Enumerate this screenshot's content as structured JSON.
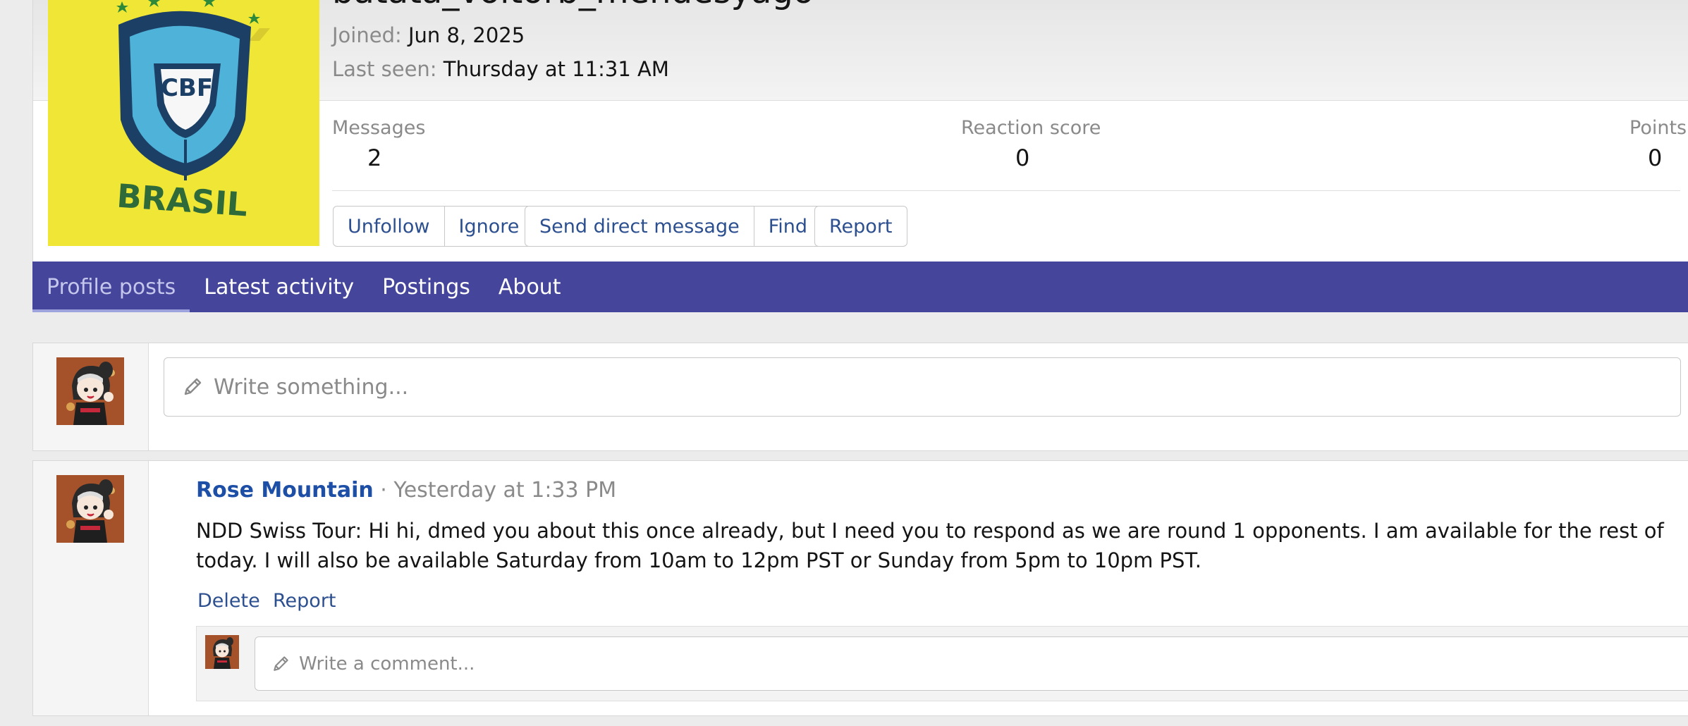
{
  "profile": {
    "username": "batata_voltorb_mendesyago",
    "avatar_text_top": "CBF",
    "avatar_text_bottom": "BRASIL",
    "joined_label": "Joined:",
    "joined_value": "Jun 8, 2025",
    "last_seen_label": "Last seen:",
    "last_seen_value": "Thursday at 11:31 AM"
  },
  "stats": [
    {
      "label": "Messages",
      "value": "2"
    },
    {
      "label": "Reaction score",
      "value": "0"
    },
    {
      "label": "Points",
      "value": "0"
    }
  ],
  "actions": {
    "unfollow": "Unfollow",
    "ignore": "Ignore",
    "send_dm": "Send direct message",
    "find": "Find",
    "report": "Report"
  },
  "tabs": [
    {
      "label": "Profile posts",
      "active": true
    },
    {
      "label": "Latest activity",
      "active": false
    },
    {
      "label": "Postings",
      "active": false
    },
    {
      "label": "About",
      "active": false
    }
  ],
  "composer": {
    "placeholder": "Write something..."
  },
  "post": {
    "author": "Rose Mountain",
    "separator": " · ",
    "timestamp": "Yesterday at 1:33 PM",
    "text": "NDD Swiss Tour: Hi hi, dmed you about this once already, but I need you to respond as we are round 1 opponents. I am available for the rest of today. I will also be available Saturday from 10am to 12pm PST or Sunday from 5pm to 10pm PST.",
    "delete_label": "Delete",
    "report_label": "Report",
    "comment_placeholder": "Write a comment..."
  },
  "colors": {
    "tab_bar": "#45469b",
    "link": "#2c4f8f",
    "author_link": "#1e4fa6",
    "avatar_bg": "#f2ea39"
  }
}
